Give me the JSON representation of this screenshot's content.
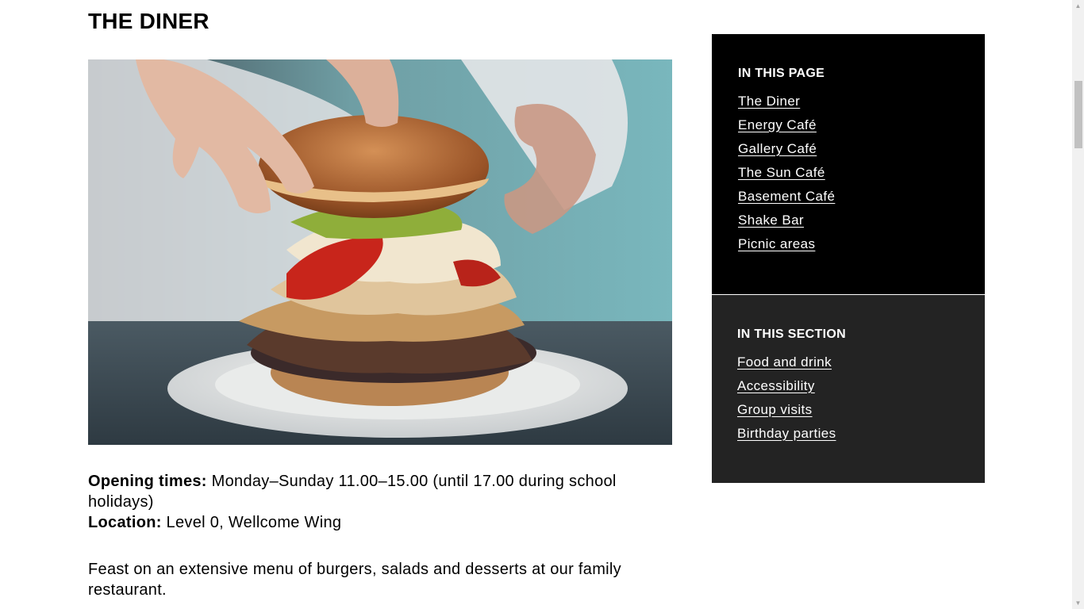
{
  "main": {
    "title": "THE DINER",
    "hero_image": "burger-photo",
    "opening_label": "Opening times:",
    "opening_value": " Monday–Sunday 11.00–15.00 (until 17.00 during school holidays)",
    "location_label": "Location:",
    "location_value": " Level 0, Wellcome Wing",
    "intro": "Feast on an extensive menu of burgers, salads and desserts at our family restaurant."
  },
  "sidebar": {
    "page_heading": "IN THIS PAGE",
    "page_links": [
      "The Diner",
      "Energy Café",
      "Gallery Café",
      "The Sun Café",
      "Basement Café",
      "Shake Bar",
      "Picnic areas"
    ],
    "section_heading": "IN THIS SECTION",
    "section_links": [
      "Food and drink",
      "Accessibility",
      "Group visits",
      "Birthday parties"
    ]
  },
  "colors": {
    "page_panel_bg": "#000000",
    "section_panel_bg": "#232323",
    "text": "#000000",
    "link_on_dark": "#ffffff"
  },
  "scrollbar": {
    "up_icon": "triangle-up-icon",
    "down_icon": "triangle-down-icon"
  }
}
